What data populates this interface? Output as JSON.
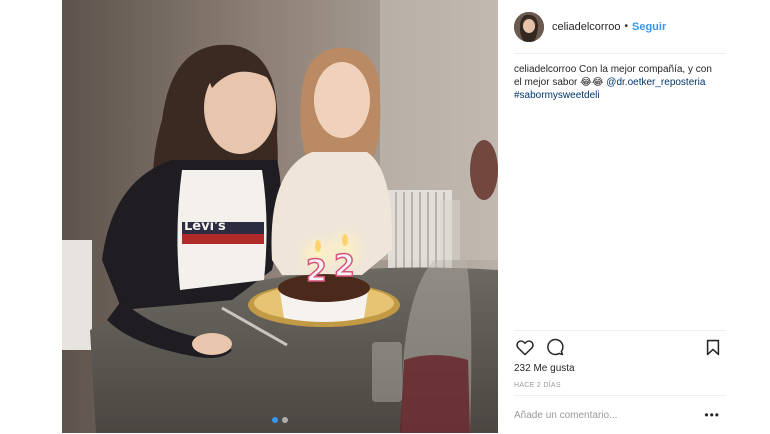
{
  "post": {
    "username": "celiadelcorroo",
    "separator": "•",
    "follow_label": "Seguir",
    "caption": {
      "user": "celiadelcorroo",
      "text": "Con la mejor compañía, y con el mejor sabor 😂😂",
      "mention": "@dr.oetker_reposteria",
      "hashtag": "#sabormysweetdeli"
    },
    "likes": "232 Me gusta",
    "timestamp": "HACE 2 DÍAS",
    "comment_placeholder": "Añade un comentario...",
    "more_label": "•••"
  },
  "photo": {
    "candle_left": "2",
    "candle_right": "2",
    "shirt_logo": "Levi's"
  },
  "carousel": {
    "total": 2,
    "active": 0
  },
  "colors": {
    "accent": "#3897f0",
    "text": "#262626",
    "muted": "#999999",
    "border": "#efefef",
    "link": "#003569"
  },
  "icons": {
    "like": "heart-icon",
    "comment": "comment-icon",
    "save": "bookmark-icon",
    "more": "more-options-icon"
  }
}
